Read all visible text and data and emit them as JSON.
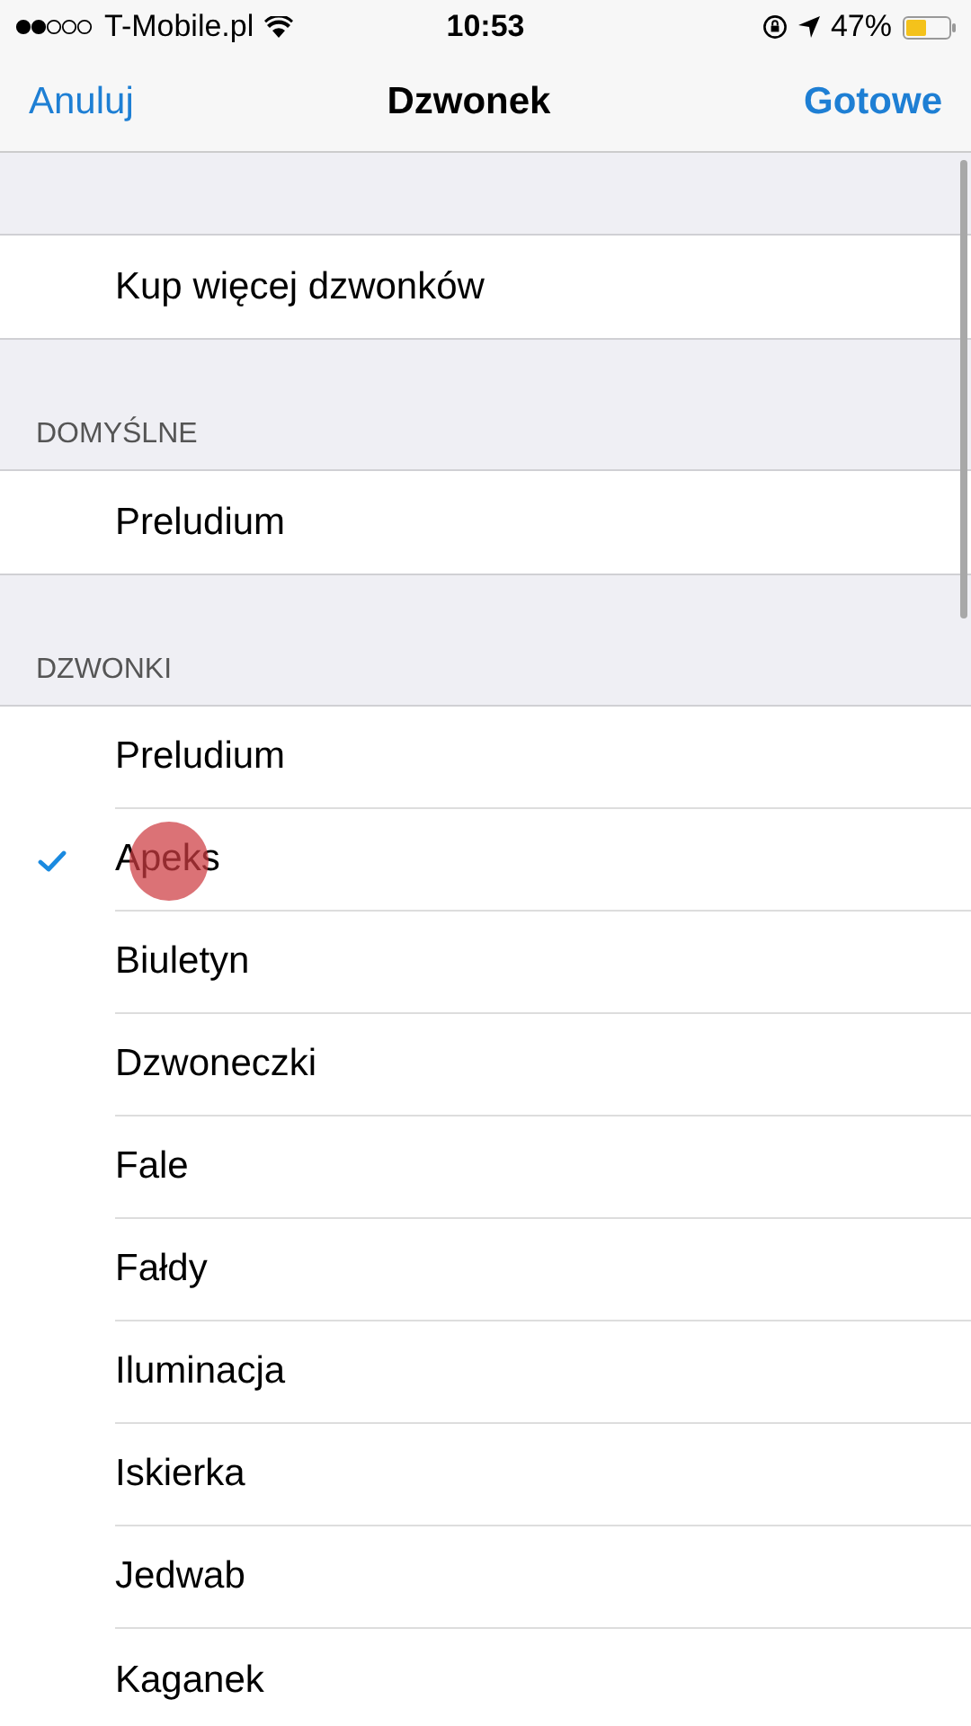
{
  "status_bar": {
    "carrier": "T-Mobile.pl",
    "time": "10:53",
    "battery_percent": "47%"
  },
  "nav": {
    "left": "Anuluj",
    "title": "Dzwonek",
    "right": "Gotowe"
  },
  "sections": [
    {
      "items": [
        {
          "label": "Kup więcej dzwonków",
          "selected": false
        }
      ]
    },
    {
      "header": "DOMYŚLNE",
      "items": [
        {
          "label": "Preludium",
          "selected": false
        }
      ]
    },
    {
      "header": "DZWONKI",
      "items": [
        {
          "label": "Preludium",
          "selected": false
        },
        {
          "label": "Apeks",
          "selected": true
        },
        {
          "label": "Biuletyn",
          "selected": false
        },
        {
          "label": "Dzwoneczki",
          "selected": false
        },
        {
          "label": "Fale",
          "selected": false
        },
        {
          "label": "Fałdy",
          "selected": false
        },
        {
          "label": "Iluminacja",
          "selected": false
        },
        {
          "label": "Iskierka",
          "selected": false
        },
        {
          "label": "Jedwab",
          "selected": false
        },
        {
          "label": "Kaganek",
          "selected": false
        }
      ]
    }
  ]
}
